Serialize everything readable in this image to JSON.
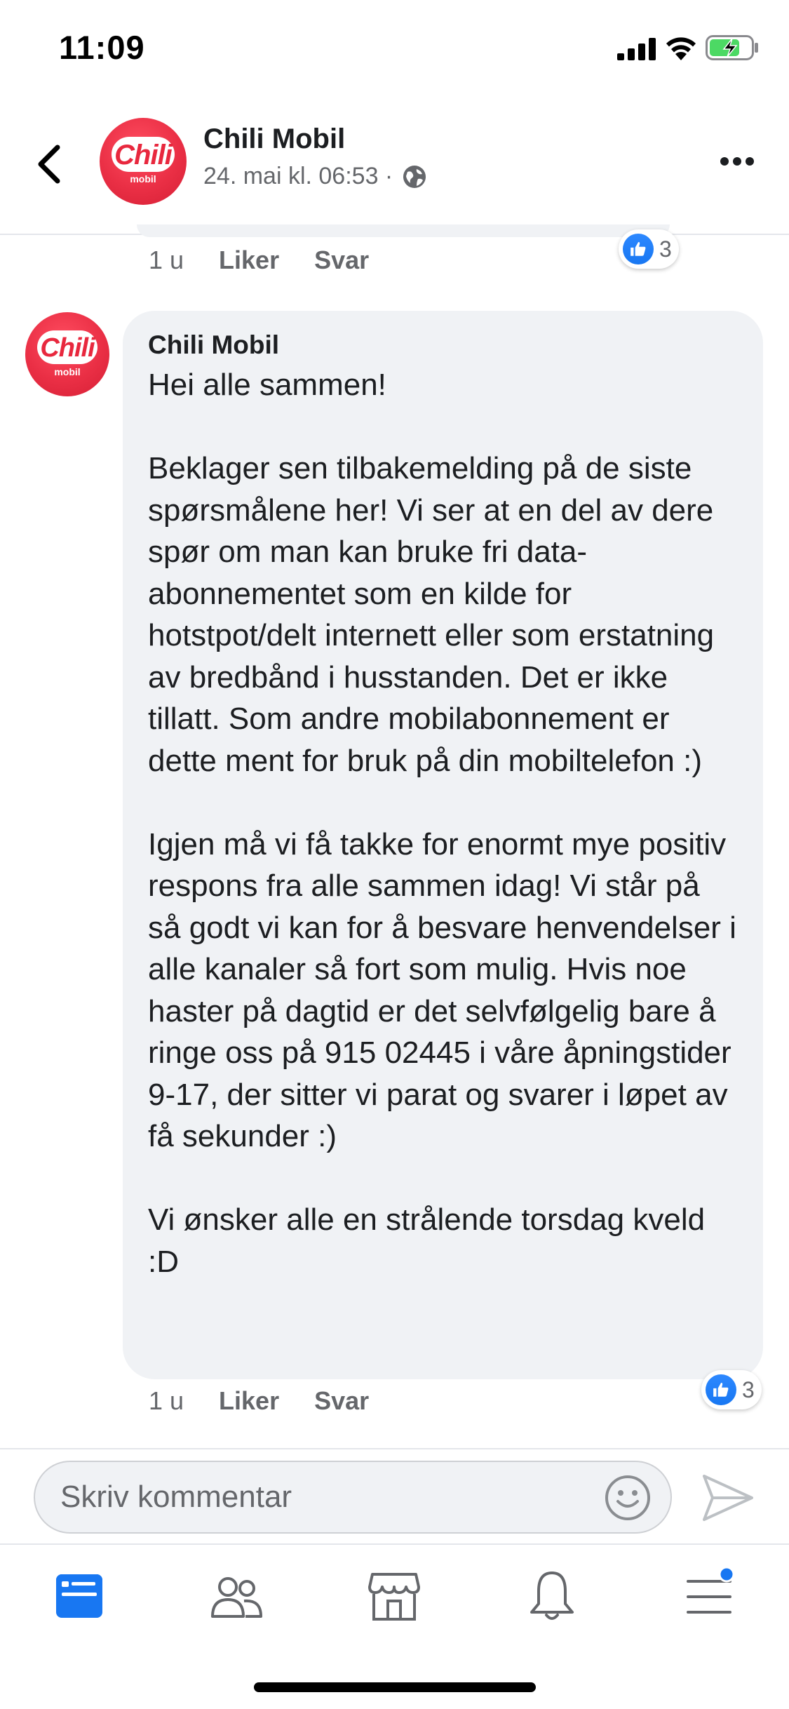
{
  "status_bar": {
    "time": "11:09"
  },
  "header": {
    "page_name": "Chili Mobil",
    "timestamp": "24. mai kl. 06:53 ·",
    "logo_text": "Chili",
    "logo_sub": "mobil"
  },
  "previous_comment": {
    "age": "1 u",
    "like_label": "Liker",
    "reply_label": "Svar",
    "reaction_count": "3"
  },
  "comment": {
    "author": "Chili Mobil",
    "paragraphs": [
      "Hei alle sammen!",
      "Beklager sen tilbakemelding på de siste spørsmålene her! Vi ser at en del av dere spør om man kan bruke fri data-abonnementet som en kilde for hotstpot/delt internett eller som erstatning av bredbånd i husstanden. Det er ikke tillatt. Som andre mobilabonnement er dette ment for bruk på din mobiltelefon :)",
      "Igjen må vi få takke for enormt mye positiv respons fra alle sammen idag! Vi står på så godt vi kan for å besvare henvendelser i alle kanaler så fort som mulig. Hvis noe haster på dagtid er det selvfølgelig bare å ringe oss på 915 02445 i våre åpningstider 9-17, der sitter vi parat og svarer i løpet av få sekunder :)",
      "Vi ønsker alle en strålende torsdag kveld :D"
    ],
    "age": "1 u",
    "like_label": "Liker",
    "reply_label": "Svar",
    "reaction_count": "3"
  },
  "composer": {
    "placeholder": "Skriv kommentar"
  },
  "tabs": [
    "news-feed",
    "groups",
    "marketplace",
    "notifications",
    "menu"
  ],
  "colors": {
    "accent": "#1877f2",
    "brand": "#e8283e",
    "bubble": "#f0f2f5",
    "secondary_text": "#65676b"
  }
}
